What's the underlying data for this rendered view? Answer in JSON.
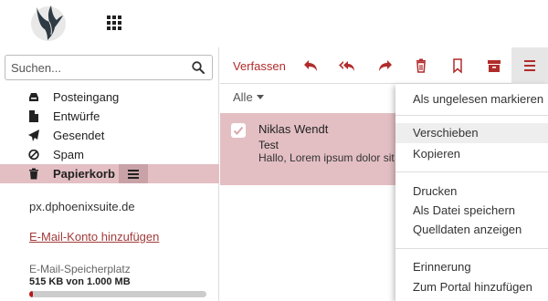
{
  "header": {
    "logo_icon": "phoenix-logo-icon",
    "apps_icon": "app-grid-icon"
  },
  "sidebar": {
    "search": {
      "placeholder": "Suchen...",
      "value": "",
      "icon": "search-icon"
    },
    "folders": [
      {
        "label": "Posteingang",
        "icon": "inbox-icon",
        "selected": false
      },
      {
        "label": "Entwürfe",
        "icon": "file-icon",
        "selected": false
      },
      {
        "label": "Gesendet",
        "icon": "send-icon",
        "selected": false
      },
      {
        "label": "Spam",
        "icon": "ban-icon",
        "selected": false
      },
      {
        "label": "Papierkorb",
        "icon": "trash-icon",
        "selected": true
      }
    ],
    "folder_menu_icon": "hamburger-icon",
    "account": "px.dphoenixsuite.de",
    "add_account_link": "E-Mail-Konto hinzufügen",
    "quota": {
      "label": "E-Mail-Speicherplatz",
      "value": "515 KB von 1.000 MB",
      "fraction": 0.0005
    }
  },
  "toolbar": {
    "compose_label": "Verfassen",
    "icons": [
      "reply-icon",
      "reply-all-icon",
      "forward-icon",
      "delete-icon",
      "bookmark-icon",
      "archive-icon",
      "more-menu-icon"
    ]
  },
  "list": {
    "filter_label": "Alle",
    "messages": [
      {
        "from": "Niklas Wendt",
        "subject": "Test",
        "preview": "Hallo, Lorem ipsum dolor sit a consetetur sadipscing elitr, sed",
        "checked": true
      }
    ]
  },
  "dropdown": {
    "items": [
      "Als ungelesen markieren",
      "Verschieben",
      "Kopieren",
      "Drucken",
      "Als Datei speichern",
      "Quelldaten anzeigen",
      "Erinnerung",
      "Zum Portal hinzufügen"
    ],
    "hovered": "Verschieben"
  },
  "colors": {
    "accent": "#b22b2b",
    "selection": "#e3bfc3",
    "quota_fill": "#b91a1a"
  }
}
